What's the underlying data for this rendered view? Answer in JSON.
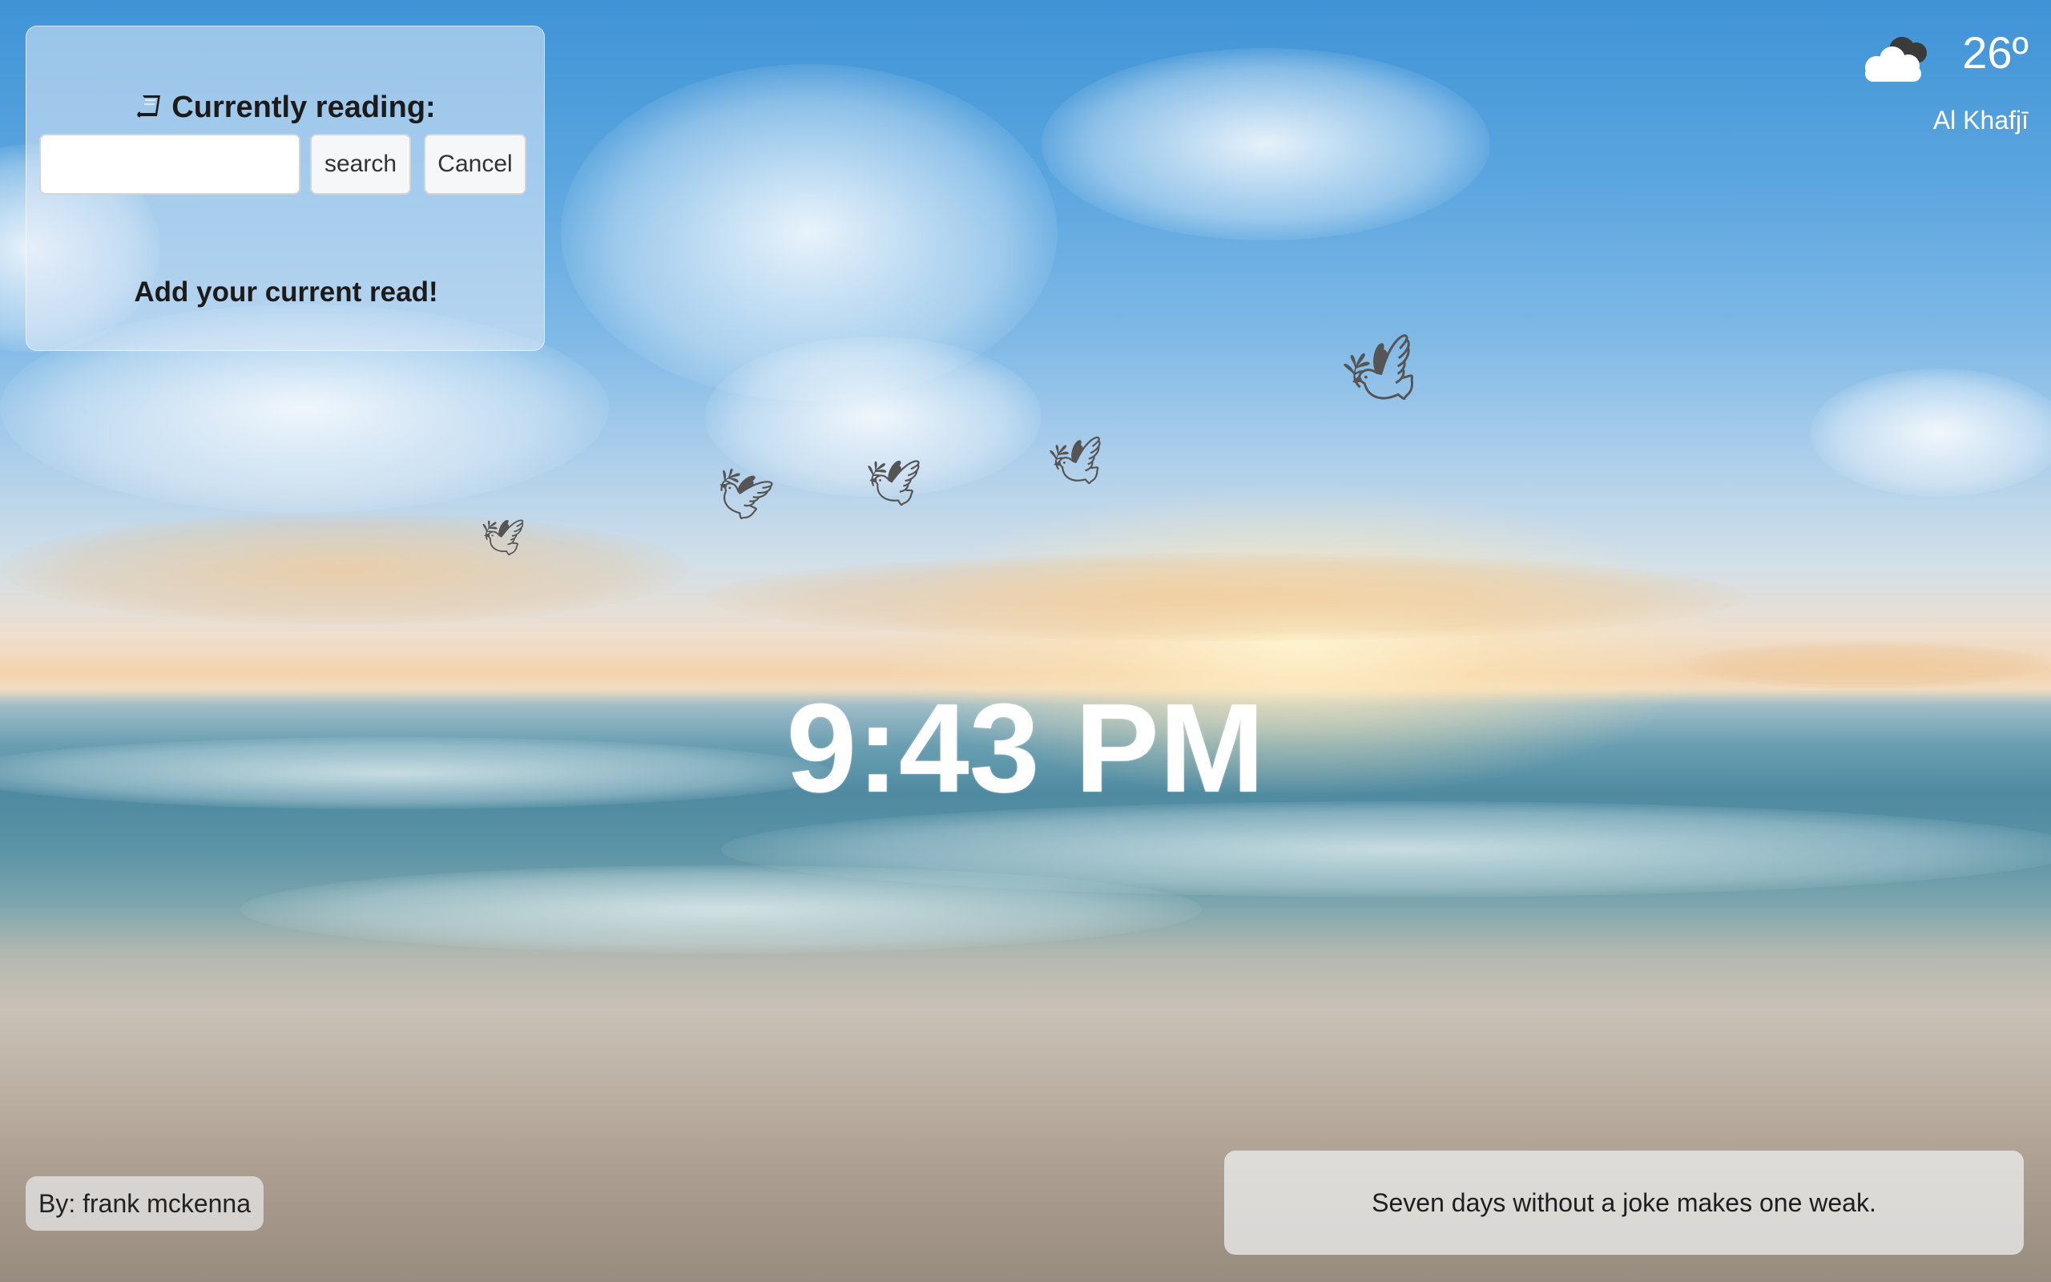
{
  "reading": {
    "title": "Currently reading:",
    "icon": "book-icon",
    "search_placeholder": "",
    "search_label": "search",
    "cancel_label": "Cancel",
    "prompt": "Add your current read!"
  },
  "weather": {
    "icon": "cloud-icon",
    "temperature": "26º",
    "city": "Al Khafjī"
  },
  "clock": {
    "time": "9:43 PM"
  },
  "author": {
    "label": "By: frank mckenna"
  },
  "quote": {
    "text": "Seven days without a joke makes one weak."
  },
  "colors": {
    "panel_bg": "#e1ebf8",
    "text_dark": "#1b1b1b",
    "white": "#ffffff"
  }
}
